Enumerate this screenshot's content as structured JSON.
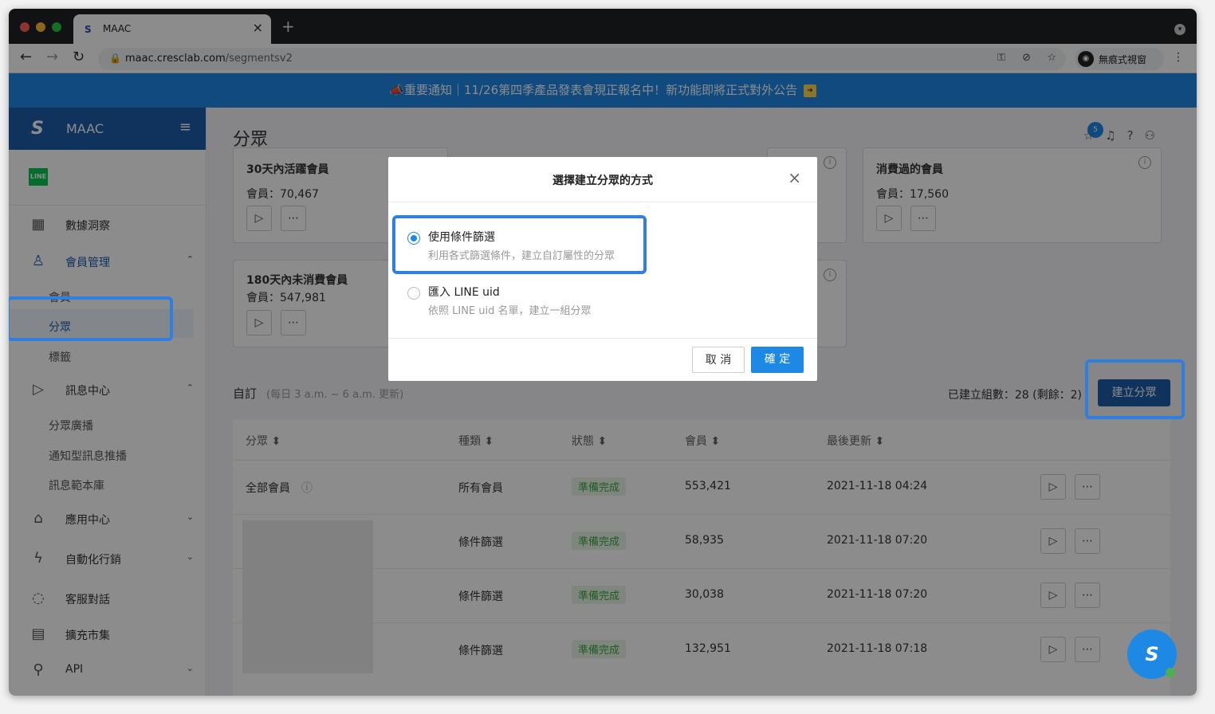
{
  "browser": {
    "tab_title": "MAAC",
    "tab_close": "×",
    "new_tab": "+",
    "url_host": "maac.cresclab.com",
    "url_path": "/segmentsv2",
    "profile_label": "無痕式視窗"
  },
  "banner": {
    "text": "重要通知｜11/26第四季產品發表會現正報名中！新功能即將正式對外公告"
  },
  "sidebar": {
    "brand": "MAAC",
    "line_badge": "LINE",
    "items": [
      {
        "label": "數據洞察"
      },
      {
        "label": "會員管理"
      },
      {
        "label": "訊息中心"
      },
      {
        "label": "應用中心"
      },
      {
        "label": "自動化行銷"
      },
      {
        "label": "客服對話"
      },
      {
        "label": "擴充市集"
      },
      {
        "label": "API"
      }
    ],
    "member_sub": [
      "會員",
      "分眾",
      "標籤"
    ],
    "message_sub": [
      "分眾廣播",
      "通知型訊息推播",
      "訊息範本庫"
    ]
  },
  "main": {
    "page_title": "分眾",
    "notif_count": "5",
    "cards": [
      {
        "title": "30天內活躍會員",
        "count": "會員：70,467"
      },
      {
        "title": "消費過的會員",
        "count": "會員：17,560"
      },
      {
        "title": "180天內未消費會員",
        "count": "會員：547,981"
      }
    ],
    "section_title": "自訂",
    "section_note": "(每日 3 a.m. ~ 6 a.m. 更新)",
    "quota": "已建立組數：28 (剩餘：2)",
    "create_button": "建立分眾",
    "table": {
      "headers": [
        "分眾",
        "種類",
        "狀態",
        "會員",
        "最後更新"
      ],
      "rows": [
        {
          "name": "全部會員",
          "type": "所有會員",
          "status": "準備完成",
          "members": "553,421",
          "updated": "2021-11-18 04:24"
        },
        {
          "name": "",
          "type": "條件篩選",
          "status": "準備完成",
          "members": "58,935",
          "updated": "2021-11-18 07:20"
        },
        {
          "name": "",
          "type": "條件篩選",
          "status": "準備完成",
          "members": "30,038",
          "updated": "2021-11-18 07:20"
        },
        {
          "name": "",
          "type": "條件篩選",
          "status": "準備完成",
          "members": "132,951",
          "updated": "2021-11-18 07:18"
        }
      ]
    }
  },
  "modal": {
    "title": "選擇建立分眾的方式",
    "close": "×",
    "options": [
      {
        "label": "使用條件篩選",
        "desc": "利用各式篩選條件，建立自訂屬性的分眾",
        "selected": true
      },
      {
        "label": "匯入 LINE uid",
        "desc": "依照 LINE uid 名單，建立一組分眾",
        "selected": false
      }
    ],
    "cancel": "取 消",
    "confirm": "確 定"
  },
  "colors": {
    "brand": "#1e5eab",
    "primary": "#1e88e5",
    "highlight": "#2f7fe0",
    "status_ok": "#3aa845"
  }
}
